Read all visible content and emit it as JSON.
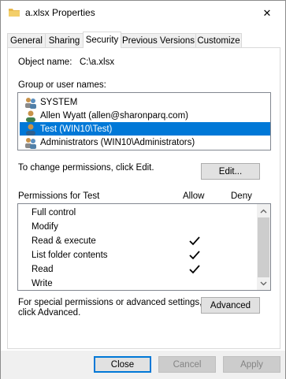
{
  "window": {
    "title": "a.xlsx Properties",
    "close_symbol": "✕"
  },
  "tabs": [
    {
      "label": "General"
    },
    {
      "label": "Sharing"
    },
    {
      "label": "Security",
      "active": true
    },
    {
      "label": "Previous Versions"
    },
    {
      "label": "Customize"
    }
  ],
  "security": {
    "object_name_label": "Object name:",
    "object_name_value": "C:\\a.xlsx",
    "groups_label": "Group or user names:",
    "users": [
      {
        "name": "SYSTEM",
        "icon": "group-users-icon",
        "selected": false
      },
      {
        "name": "Allen Wyatt (allen@sharonparq.com)",
        "icon": "user-icon",
        "selected": false
      },
      {
        "name": "Test (WIN10\\Test)",
        "icon": "user-icon",
        "selected": true
      },
      {
        "name": "Administrators (WIN10\\Administrators)",
        "icon": "group-users-icon",
        "selected": false
      }
    ],
    "change_hint": "To change permissions, click Edit.",
    "edit_button": "Edit...",
    "permissions_label": "Permissions for Test",
    "allow_header": "Allow",
    "deny_header": "Deny",
    "permissions": [
      {
        "name": "Full control",
        "allow": false,
        "deny": false
      },
      {
        "name": "Modify",
        "allow": false,
        "deny": false
      },
      {
        "name": "Read & execute",
        "allow": true,
        "deny": false
      },
      {
        "name": "List folder contents",
        "allow": true,
        "deny": false
      },
      {
        "name": "Read",
        "allow": true,
        "deny": false
      },
      {
        "name": "Write",
        "allow": false,
        "deny": false
      }
    ],
    "advanced_hint_line1": "For special permissions or advanced settings,",
    "advanced_hint_line2": "click Advanced.",
    "advanced_button": "Advanced"
  },
  "footer": {
    "close_button": "Close",
    "cancel_button": "Cancel",
    "apply_button": "Apply"
  },
  "colors": {
    "selection": "#0078d7",
    "button_face": "#e1e1e1",
    "disabled_text": "#838383"
  }
}
